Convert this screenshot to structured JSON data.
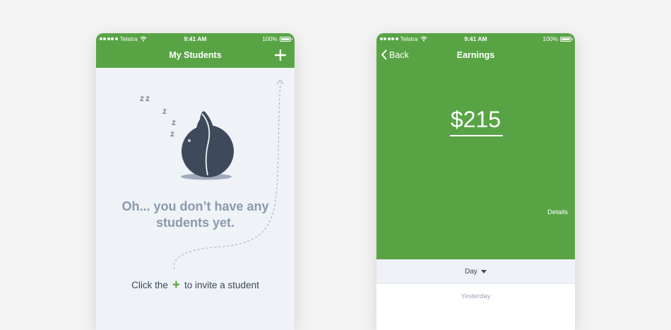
{
  "status_bar": {
    "carrier": "Telstra",
    "time": "9:41 AM",
    "battery": "100%"
  },
  "students_screen": {
    "title": "My Students",
    "add_icon": "plus-icon",
    "sleep_z": [
      "z",
      "z",
      "z",
      "z",
      "z"
    ],
    "empty_line_1": "Oh... you don’t have any",
    "empty_line_2": "students yet.",
    "invite_prefix": "Click the",
    "invite_plus": "+",
    "invite_suffix": "to invite a student"
  },
  "earnings_screen": {
    "back_label": "Back",
    "title": "Earnings",
    "amount": "$215",
    "details_label": "Details",
    "period_selected": "Day",
    "section_label": "Yesterday"
  },
  "colors": {
    "brand_green": "#58a445",
    "background": "#f3f3f3",
    "empty_bg": "#eff2f6",
    "mascot": "#3e4a5c",
    "muted_text": "#8a99ad"
  }
}
